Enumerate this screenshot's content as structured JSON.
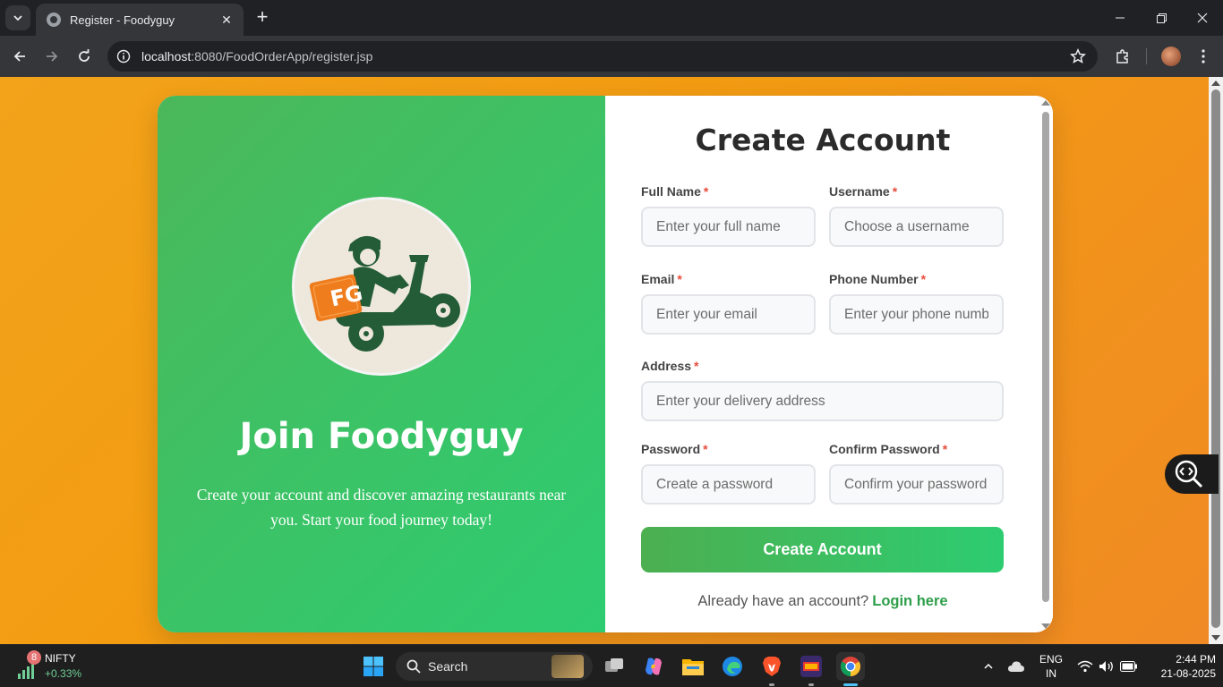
{
  "browser": {
    "tab_title": "Register - Foodyguy",
    "url_host": "localhost",
    "url_path": ":8080/FoodOrderApp/register.jsp"
  },
  "hero": {
    "logo_text": "FG",
    "title": "Join Foodyguy",
    "description": "Create your account and discover amazing restaurants near you. Start your food journey today!"
  },
  "form": {
    "title": "Create Account",
    "required_mark": "*",
    "fields": {
      "full_name": {
        "label": "Full Name",
        "placeholder": "Enter your full name"
      },
      "username": {
        "label": "Username",
        "placeholder": "Choose a username"
      },
      "email": {
        "label": "Email",
        "placeholder": "Enter your email"
      },
      "phone": {
        "label": "Phone Number",
        "placeholder": "Enter your phone number"
      },
      "address": {
        "label": "Address",
        "placeholder": "Enter your delivery address"
      },
      "password": {
        "label": "Password",
        "placeholder": "Create a password"
      },
      "confirm_password": {
        "label": "Confirm Password",
        "placeholder": "Confirm your password"
      }
    },
    "submit_label": "Create Account",
    "login_prompt": "Already have an account?",
    "login_link": "Login here"
  },
  "taskbar": {
    "stock_badge": "8",
    "stock_name": "NIFTY",
    "stock_change": "+0.33%",
    "search_label": "Search",
    "language_line1": "ENG",
    "language_line2": "IN",
    "time": "2:44 PM",
    "date": "21-08-2025"
  },
  "colors": {
    "page_background": "#f39c12",
    "hero_green": "#2ecc71",
    "accent_green": "#2e9e4a",
    "required_red": "#e74c3c"
  }
}
